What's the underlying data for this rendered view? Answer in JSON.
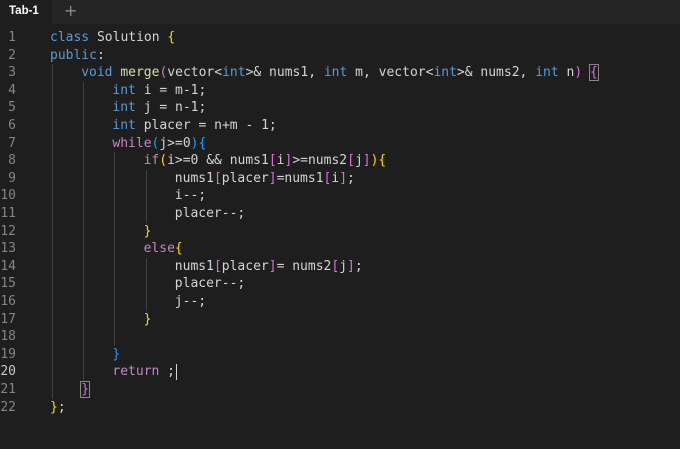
{
  "tabs": [
    {
      "label": "Tab-1",
      "active": true
    }
  ],
  "new_tab_label": "+",
  "editor": {
    "active_line": 20,
    "language": "cpp",
    "lines": [
      {
        "number": "1",
        "indent": 0,
        "tokens": [
          [
            "kw",
            "class"
          ],
          [
            "",
            "  "
          ],
          [
            "ty",
            "Solution"
          ],
          [
            "",
            ""
          ],
          [
            "",
            ""
          ],
          [
            "b1",
            "{"
          ]
        ]
      },
      {
        "number": "2",
        "indent": 0,
        "tokens": [
          [
            "kw",
            "public"
          ],
          [
            "",
            ":"
          ]
        ]
      },
      {
        "number": "3",
        "indent": 1,
        "tokens": [
          [
            "kw",
            "void"
          ],
          [
            "",
            " "
          ],
          [
            "fn",
            "merge"
          ],
          [
            "b2",
            "("
          ],
          [
            "",
            "vector"
          ],
          [
            "",
            "<"
          ],
          [
            "kw",
            "int"
          ],
          [
            "",
            ">& nums1, "
          ],
          [
            "kw",
            "int"
          ],
          [
            "",
            " m, vector<"
          ],
          [
            "kw",
            "int"
          ],
          [
            "",
            ">& nums2, "
          ],
          [
            "kw",
            "int"
          ],
          [
            "",
            " n"
          ],
          [
            "b2",
            ")"
          ],
          [
            "",
            " "
          ],
          [
            "b2 bm",
            "{"
          ]
        ]
      },
      {
        "number": "4",
        "indent": 2,
        "tokens": [
          [
            "kw",
            "int"
          ],
          [
            "",
            " i = m-1;"
          ]
        ]
      },
      {
        "number": "5",
        "indent": 2,
        "tokens": [
          [
            "kw",
            "int"
          ],
          [
            "",
            " j = n-1;"
          ]
        ]
      },
      {
        "number": "6",
        "indent": 2,
        "tokens": [
          [
            "kw",
            "int"
          ],
          [
            "",
            " placer = n+m - 1;"
          ]
        ]
      },
      {
        "number": "7",
        "indent": 2,
        "tokens": [
          [
            "ctl",
            "while"
          ],
          [
            "b3",
            "("
          ],
          [
            "",
            "j>=0"
          ],
          [
            "b3",
            ")"
          ],
          [
            "b3",
            "{"
          ]
        ]
      },
      {
        "number": "8",
        "indent": 3,
        "tokens": [
          [
            "ctl",
            "if"
          ],
          [
            "b1",
            "("
          ],
          [
            "",
            "i>=0 && nums1"
          ],
          [
            "b2",
            "["
          ],
          [
            "",
            "i"
          ],
          [
            "b2",
            "]"
          ],
          [
            "",
            ">=nums2"
          ],
          [
            "b2",
            "["
          ],
          [
            "",
            "j"
          ],
          [
            "b2",
            "]"
          ],
          [
            "b1",
            ")"
          ],
          [
            "b1",
            "{"
          ]
        ]
      },
      {
        "number": "9",
        "indent": 4,
        "tokens": [
          [
            "",
            "nums1"
          ],
          [
            "b2",
            "["
          ],
          [
            "",
            "placer"
          ],
          [
            "b2",
            "]"
          ],
          [
            "",
            "=nums1"
          ],
          [
            "b2",
            "["
          ],
          [
            "",
            "i"
          ],
          [
            "b2",
            "]"
          ],
          [
            "",
            ";"
          ]
        ]
      },
      {
        "number": "10",
        "indent": 4,
        "tokens": [
          [
            "",
            "i--;"
          ]
        ]
      },
      {
        "number": "11",
        "indent": 4,
        "tokens": [
          [
            "",
            "placer--;"
          ]
        ]
      },
      {
        "number": "12",
        "indent": 3,
        "tokens": [
          [
            "b1",
            "}"
          ]
        ]
      },
      {
        "number": "13",
        "indent": 3,
        "tokens": [
          [
            "ctl",
            "else"
          ],
          [
            "b1",
            "{"
          ]
        ]
      },
      {
        "number": "14",
        "indent": 4,
        "tokens": [
          [
            "",
            "nums1"
          ],
          [
            "b2",
            "["
          ],
          [
            "",
            "placer"
          ],
          [
            "b2",
            "]"
          ],
          [
            "",
            "= nums2"
          ],
          [
            "b2",
            "["
          ],
          [
            "",
            "j"
          ],
          [
            "b2",
            "]"
          ],
          [
            "",
            ";"
          ]
        ]
      },
      {
        "number": "15",
        "indent": 4,
        "tokens": [
          [
            "",
            "placer--;"
          ]
        ]
      },
      {
        "number": "16",
        "indent": 4,
        "tokens": [
          [
            "",
            "j--;"
          ]
        ]
      },
      {
        "number": "17",
        "indent": 3,
        "tokens": [
          [
            "b1",
            "}"
          ]
        ]
      },
      {
        "number": "18",
        "indent": 0,
        "tokens": []
      },
      {
        "number": "19",
        "indent": 2,
        "tokens": [
          [
            "b3",
            "}"
          ]
        ]
      },
      {
        "number": "20",
        "indent": 2,
        "tokens": [
          [
            "ctl",
            "return"
          ],
          [
            "",
            " ;"
          ]
        ]
      },
      {
        "number": "21",
        "indent": 1,
        "tokens": [
          [
            "b2 bm",
            "}"
          ]
        ]
      },
      {
        "number": "22",
        "indent": 0,
        "tokens": [
          [
            "b1",
            "}"
          ],
          [
            "",
            ";"
          ]
        ]
      }
    ]
  },
  "colors": {
    "background": "#1e1e1e",
    "keyword": "#569cd6",
    "control": "#c586c0",
    "function": "#dcdcaa",
    "bracket_level1": "#ffd700",
    "bracket_level2": "#da70d6",
    "bracket_level3": "#179fff"
  }
}
